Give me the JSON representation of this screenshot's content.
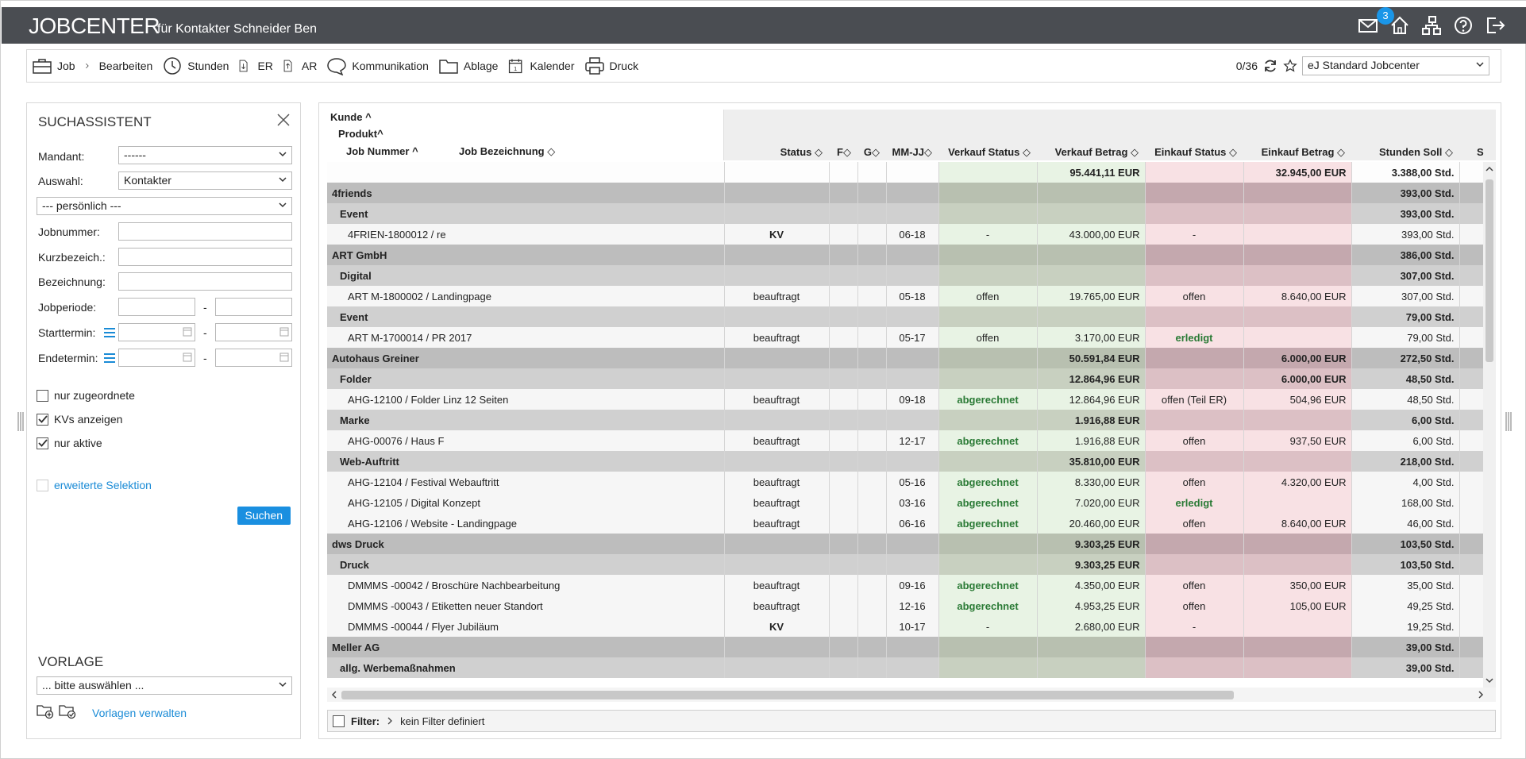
{
  "app": {
    "brand": "JOBCENTER",
    "subtitle": "für Kontakter Schneider Ben",
    "mail_badge": "3"
  },
  "toolbar": {
    "items": [
      {
        "label": "Job",
        "icon": "briefcase-icon"
      },
      {
        "label": "Bearbeiten",
        "icon": "chevron-right-icon"
      },
      {
        "label": "Stunden",
        "icon": "clock-icon"
      },
      {
        "label": "ER",
        "icon": "download-doc-icon"
      },
      {
        "label": "AR",
        "icon": "upload-doc-icon"
      },
      {
        "label": "Kommunikation",
        "icon": "speech-bubble-icon"
      },
      {
        "label": "Ablage",
        "icon": "folder-icon"
      },
      {
        "label": "Kalender",
        "icon": "calendar-icon"
      },
      {
        "label": "Druck",
        "icon": "printer-icon"
      }
    ],
    "counter": "0/36",
    "view_select": "eJ Standard Jobcenter"
  },
  "sidebar": {
    "title": "SUCHASSISTENT",
    "mandant_label": "Mandant:",
    "mandant_value": "------",
    "auswahl_label": "Auswahl:",
    "auswahl_value": "Kontakter",
    "scope_value": "--- persönlich ---",
    "jobnummer_label": "Jobnummer:",
    "kurzbez_label": "Kurzbezeich.:",
    "bezeichnung_label": "Bezeichnung:",
    "jobperiode_label": "Jobperiode:",
    "starttermin_label": "Starttermin:",
    "endetermin_label": "Endetermin:",
    "range_sep": "-",
    "cb_zugeordnete": "nur zugeordnete",
    "cb_kvs": "KVs anzeigen",
    "cb_aktive": "nur aktive",
    "erweiterte": "erweiterte Selektion",
    "search_button": "Suchen",
    "vorlage_title": "VORLAGE",
    "vorlage_select": "... bitte auswählen ...",
    "vorlagen_link": "Vorlagen verwalten"
  },
  "grid": {
    "group_headers": {
      "kunde": "Kunde",
      "produkt": "Produkt",
      "jobnummer": "Job Nummer",
      "jobbez": "Job Bezeichnung"
    },
    "columns": {
      "status": "Status",
      "f": "F",
      "g": "G",
      "mmjj": "MM-JJ",
      "vk_status": "Verkauf Status",
      "vk_betrag": "Verkauf Betrag",
      "ek_status": "Einkauf Status",
      "ek_betrag": "Einkauf Betrag",
      "stunden": "Stunden Soll",
      "more": "S"
    },
    "totals": {
      "vk_betrag": "95.441,11 EUR",
      "ek_betrag": "32.945,00 EUR",
      "stunden": "3.388,00 Std."
    },
    "rows": [
      {
        "type": "lvl0",
        "name": "4friends",
        "status": "",
        "mmjj": "",
        "vk_status": "",
        "vk_betrag": "",
        "ek_status": "",
        "ek_betrag": "",
        "stunden": "393,00 Std."
      },
      {
        "type": "lvl1",
        "name": "Event",
        "status": "",
        "mmjj": "",
        "vk_status": "",
        "vk_betrag": "",
        "ek_status": "",
        "ek_betrag": "",
        "stunden": "393,00 Std."
      },
      {
        "type": "job",
        "name": "4FRIEN-1800012 / re",
        "status": "KV",
        "mmjj": "06-18",
        "vk_status": "-",
        "vk_betrag": "43.000,00 EUR",
        "ek_status": "-",
        "ek_betrag": "",
        "stunden": "393,00 Std."
      },
      {
        "type": "lvl0",
        "name": "ART GmbH",
        "status": "",
        "mmjj": "",
        "vk_status": "",
        "vk_betrag": "",
        "ek_status": "",
        "ek_betrag": "",
        "stunden": "386,00 Std."
      },
      {
        "type": "lvl1",
        "name": "Digital",
        "status": "",
        "mmjj": "",
        "vk_status": "",
        "vk_betrag": "",
        "ek_status": "",
        "ek_betrag": "",
        "stunden": "307,00 Std."
      },
      {
        "type": "job",
        "name": "ART M-1800002 / Landingpage",
        "status": "beauftragt",
        "mmjj": "05-18",
        "vk_status": "offen",
        "vk_betrag": "19.765,00 EUR",
        "ek_status": "offen",
        "ek_betrag": "8.640,00 EUR",
        "stunden": "307,00 Std."
      },
      {
        "type": "lvl1",
        "name": "Event",
        "status": "",
        "mmjj": "",
        "vk_status": "",
        "vk_betrag": "",
        "ek_status": "",
        "ek_betrag": "",
        "stunden": "79,00 Std."
      },
      {
        "type": "job",
        "name": "ART M-1700014 / PR 2017",
        "status": "beauftragt",
        "mmjj": "05-17",
        "vk_status": "offen",
        "vk_betrag": "3.170,00 EUR",
        "ek_status": "erledigt",
        "ek_betrag": "",
        "stunden": "79,00 Std."
      },
      {
        "type": "lvl0",
        "name": "Autohaus Greiner",
        "status": "",
        "mmjj": "",
        "vk_status": "",
        "vk_betrag": "50.591,84 EUR",
        "ek_status": "",
        "ek_betrag": "6.000,00 EUR",
        "stunden": "272,50 Std."
      },
      {
        "type": "lvl1",
        "name": "Folder",
        "status": "",
        "mmjj": "",
        "vk_status": "",
        "vk_betrag": "12.864,96 EUR",
        "ek_status": "",
        "ek_betrag": "6.000,00 EUR",
        "stunden": "48,50 Std."
      },
      {
        "type": "job",
        "name": "AHG-12100 / Folder Linz 12 Seiten",
        "status": "beauftragt",
        "mmjj": "09-18",
        "vk_status": "abgerechnet",
        "vk_betrag": "12.864,96 EUR",
        "ek_status": "offen (Teil ER)",
        "ek_betrag": "504,96 EUR",
        "stunden": "48,50 Std."
      },
      {
        "type": "lvl1",
        "name": "Marke",
        "status": "",
        "mmjj": "",
        "vk_status": "",
        "vk_betrag": "1.916,88 EUR",
        "ek_status": "",
        "ek_betrag": "",
        "stunden": "6,00 Std."
      },
      {
        "type": "job",
        "name": "AHG-00076 / Haus F",
        "status": "beauftragt",
        "mmjj": "12-17",
        "vk_status": "abgerechnet",
        "vk_betrag": "1.916,88 EUR",
        "ek_status": "offen",
        "ek_betrag": "937,50 EUR",
        "stunden": "6,00 Std."
      },
      {
        "type": "lvl1",
        "name": "Web-Auftritt",
        "status": "",
        "mmjj": "",
        "vk_status": "",
        "vk_betrag": "35.810,00 EUR",
        "ek_status": "",
        "ek_betrag": "",
        "stunden": "218,00 Std."
      },
      {
        "type": "job",
        "name": "AHG-12104 / Festival Webauftritt",
        "status": "beauftragt",
        "mmjj": "05-16",
        "vk_status": "abgerechnet",
        "vk_betrag": "8.330,00 EUR",
        "ek_status": "offen",
        "ek_betrag": "4.320,00 EUR",
        "stunden": "4,00 Std."
      },
      {
        "type": "job",
        "name": "AHG-12105 / Digital Konzept",
        "status": "beauftragt",
        "mmjj": "03-16",
        "vk_status": "abgerechnet",
        "vk_betrag": "7.020,00 EUR",
        "ek_status": "erledigt",
        "ek_betrag": "",
        "stunden": "168,00 Std."
      },
      {
        "type": "job",
        "name": "AHG-12106 / Website - Landingpage",
        "status": "beauftragt",
        "mmjj": "06-16",
        "vk_status": "abgerechnet",
        "vk_betrag": "20.460,00 EUR",
        "ek_status": "offen",
        "ek_betrag": "8.640,00 EUR",
        "stunden": "46,00 Std."
      },
      {
        "type": "lvl0",
        "name": "dws Druck",
        "status": "",
        "mmjj": "",
        "vk_status": "",
        "vk_betrag": "9.303,25 EUR",
        "ek_status": "",
        "ek_betrag": "",
        "stunden": "103,50 Std."
      },
      {
        "type": "lvl1",
        "name": "Druck",
        "status": "",
        "mmjj": "",
        "vk_status": "",
        "vk_betrag": "9.303,25 EUR",
        "ek_status": "",
        "ek_betrag": "",
        "stunden": "103,50 Std."
      },
      {
        "type": "job",
        "name": "DMMMS -00042 / Broschüre Nachbearbeitung",
        "status": "beauftragt",
        "mmjj": "09-16",
        "vk_status": "abgerechnet",
        "vk_betrag": "4.350,00 EUR",
        "ek_status": "offen",
        "ek_betrag": "350,00 EUR",
        "stunden": "35,00 Std."
      },
      {
        "type": "job",
        "name": "DMMMS -00043 / Etiketten neuer Standort",
        "status": "beauftragt",
        "mmjj": "12-16",
        "vk_status": "abgerechnet",
        "vk_betrag": "4.953,25 EUR",
        "ek_status": "offen",
        "ek_betrag": "105,00 EUR",
        "stunden": "49,25 Std."
      },
      {
        "type": "job",
        "name": "DMMMS -00044 / Flyer Jubiläum",
        "status": "KV",
        "mmjj": "10-17",
        "vk_status": "-",
        "vk_betrag": "2.680,00 EUR",
        "ek_status": "-",
        "ek_betrag": "",
        "stunden": "19,25 Std."
      },
      {
        "type": "lvl0",
        "name": "Meller AG",
        "status": "",
        "mmjj": "",
        "vk_status": "",
        "vk_betrag": "",
        "ek_status": "",
        "ek_betrag": "",
        "stunden": "39,00 Std."
      },
      {
        "type": "lvl1",
        "name": "allg. Werbemaßnahmen",
        "status": "",
        "mmjj": "",
        "vk_status": "",
        "vk_betrag": "",
        "ek_status": "",
        "ek_betrag": "",
        "stunden": "39,00 Std."
      }
    ]
  },
  "filter": {
    "label": "Filter:",
    "value": "kein Filter definiert"
  }
}
